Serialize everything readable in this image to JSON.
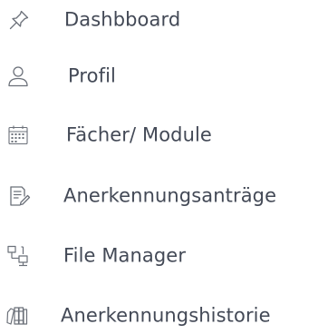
{
  "sidebar": {
    "items": [
      {
        "label": "Dashbboard",
        "icon": "pin-icon"
      },
      {
        "label": "Profil",
        "icon": "user-icon"
      },
      {
        "label": "Fächer/ Module",
        "icon": "calendar-icon"
      },
      {
        "label": "Anerkennungsanträge",
        "icon": "document-edit-icon"
      },
      {
        "label": "File Manager",
        "icon": "network-icon"
      },
      {
        "label": "Anerkennungshistorie",
        "icon": "books-icon"
      }
    ]
  },
  "colors": {
    "text": "#434956",
    "icon": "#6b7079",
    "background": "#ffffff"
  }
}
